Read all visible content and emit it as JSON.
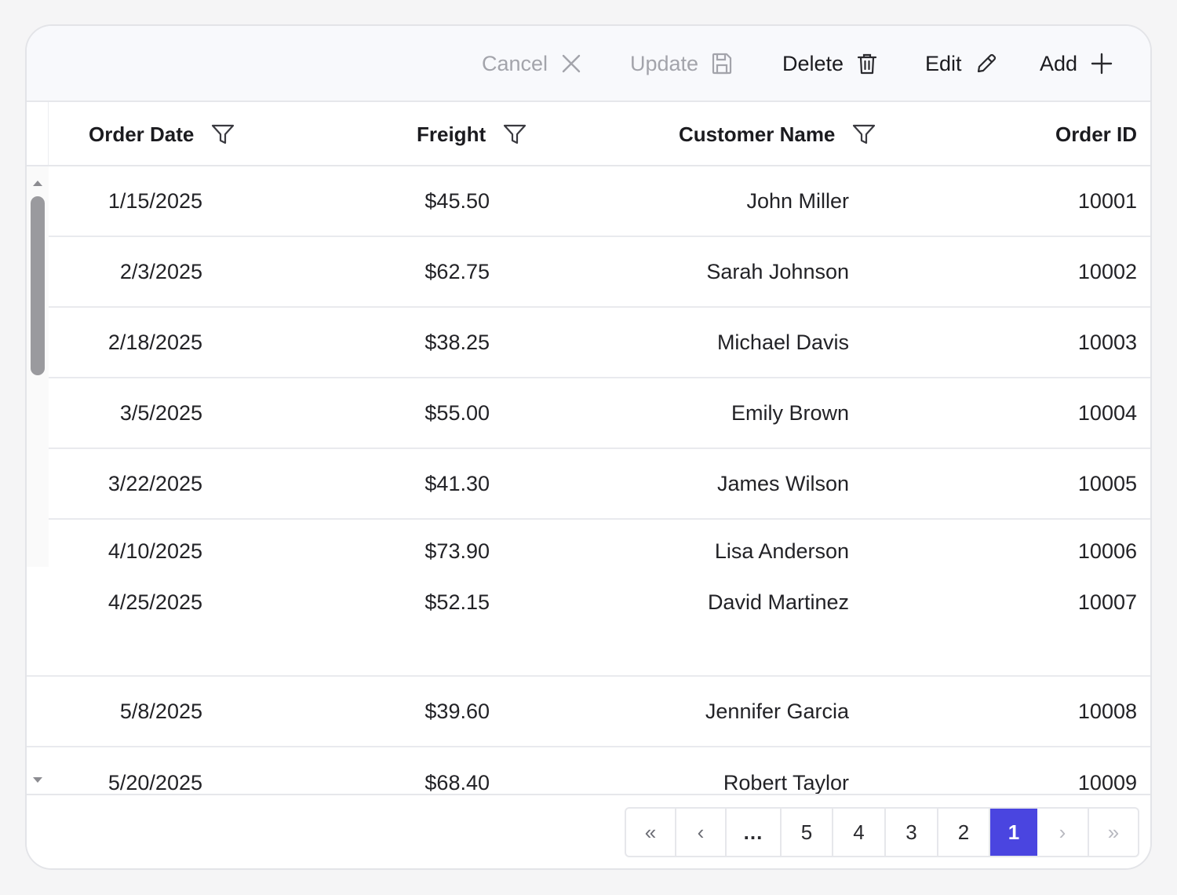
{
  "toolbar": {
    "cancel_label": "Cancel",
    "update_label": "Update",
    "delete_label": "Delete",
    "edit_label": "Edit",
    "add_label": "Add"
  },
  "columns": {
    "order_date": "Order Date",
    "freight": "Freight",
    "customer_name": "Customer Name",
    "order_id": "Order ID"
  },
  "rows": [
    {
      "date": "1/15/2025",
      "freight": "$45.50",
      "name": "John Miller",
      "id": "10001"
    },
    {
      "date": "2/3/2025",
      "freight": "$62.75",
      "name": "Sarah Johnson",
      "id": "10002"
    },
    {
      "date": "2/18/2025",
      "freight": "$38.25",
      "name": "Michael Davis",
      "id": "10003"
    },
    {
      "date": "3/5/2025",
      "freight": "$55.00",
      "name": "Emily Brown",
      "id": "10004"
    },
    {
      "date": "3/22/2025",
      "freight": "$41.30",
      "name": "James Wilson",
      "id": "10005"
    },
    {
      "date": "4/10/2025",
      "freight": "$73.90",
      "name": "Lisa Anderson",
      "id": "10006"
    },
    {
      "date": "4/25/2025",
      "freight": "$52.15",
      "name": "David Martinez",
      "id": "10007"
    },
    {
      "date": "5/8/2025",
      "freight": "$39.60",
      "name": "Jennifer Garcia",
      "id": "10008"
    },
    {
      "date": "5/20/2025",
      "freight": "$68.40",
      "name": "Robert Taylor",
      "id": "10009"
    }
  ],
  "pager": {
    "first": "«",
    "prev": "‹",
    "ellipsis": "...",
    "pages": [
      "5",
      "4",
      "3",
      "2",
      "1"
    ],
    "next": "›",
    "last": "»",
    "current_page": "1"
  },
  "colors": {
    "accent": "#4a45e0",
    "toolbar_bg": "#f8f9fc",
    "disabled_text": "#a3a4ab",
    "border": "#e6e7eb"
  },
  "icons": {
    "cancel": "close-icon",
    "update": "save-icon",
    "delete": "trash-icon",
    "edit": "pencil-icon",
    "add": "plus-icon",
    "filter": "filter-icon"
  }
}
